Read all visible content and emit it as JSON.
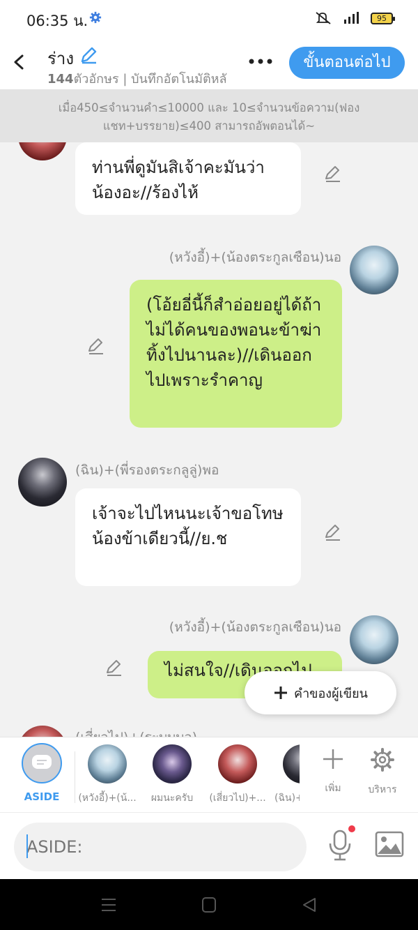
{
  "status_bar": {
    "time": "06:35 น.",
    "battery": "95"
  },
  "header": {
    "title": "ร่าง",
    "char_count": "144",
    "subtitle_rest": "ตัวอักษร | บันทึกอัตโนมัติหลั",
    "next_label": "ขั้นตอนต่อไป"
  },
  "notice": "เมื่อ450≤จำนวนคำ≤10000 และ 10≤จำนวนข้อความ(ฟองแชท+บรรยาย)≤400 สามารถอัพตอนได้~",
  "messages": [
    {
      "text": "ท่านพี่ดูมันสิเจ้าคะมันว่าน้องอะ//ร้องไห้"
    },
    {
      "name": "(หวังอี้)+(น้องตระกูลเซือน)นอ",
      "text": "(โอ้ยอี่นี้ก็สำอ่อยอยู่ได้ถ้าไม่ได้คนของพอนะข้าฆ่าทิ้งไปนานละ)//เดินออกไปเพราะรำคาญ"
    },
    {
      "name": "(ฉิน)+(พี่รองตระกลูลู่)พอ",
      "text": "เจ้าจะไปไหนนะเจ้าขอโทษน้องข้าเดียวนี้//ย.ช"
    },
    {
      "name": "(หวังอี้)+(น้องตระกูลเซือน)นอ",
      "text": "ไม่สนใจ//เดินออกไป"
    },
    {
      "name": "(เสี่ยวไป)+(ระบบบอ)"
    }
  ],
  "fab_label": "คำของผู้เขียน",
  "characters": [
    {
      "label": "ASIDE"
    },
    {
      "label": "(หวังอี้)+(น้..."
    },
    {
      "label": "ผมนะครับ"
    },
    {
      "label": "(เสี่ยวไป)+..."
    },
    {
      "label": "(ฉิน)+"
    }
  ],
  "tools": {
    "add_label": "เพิ่ม",
    "manage_label": "บริหาร"
  },
  "input": {
    "placeholder": "ASIDE:"
  },
  "colors": {
    "accent": "#3f9bef",
    "green_bubble": "#cdef88",
    "mic_dot": "#ef3b4a"
  }
}
